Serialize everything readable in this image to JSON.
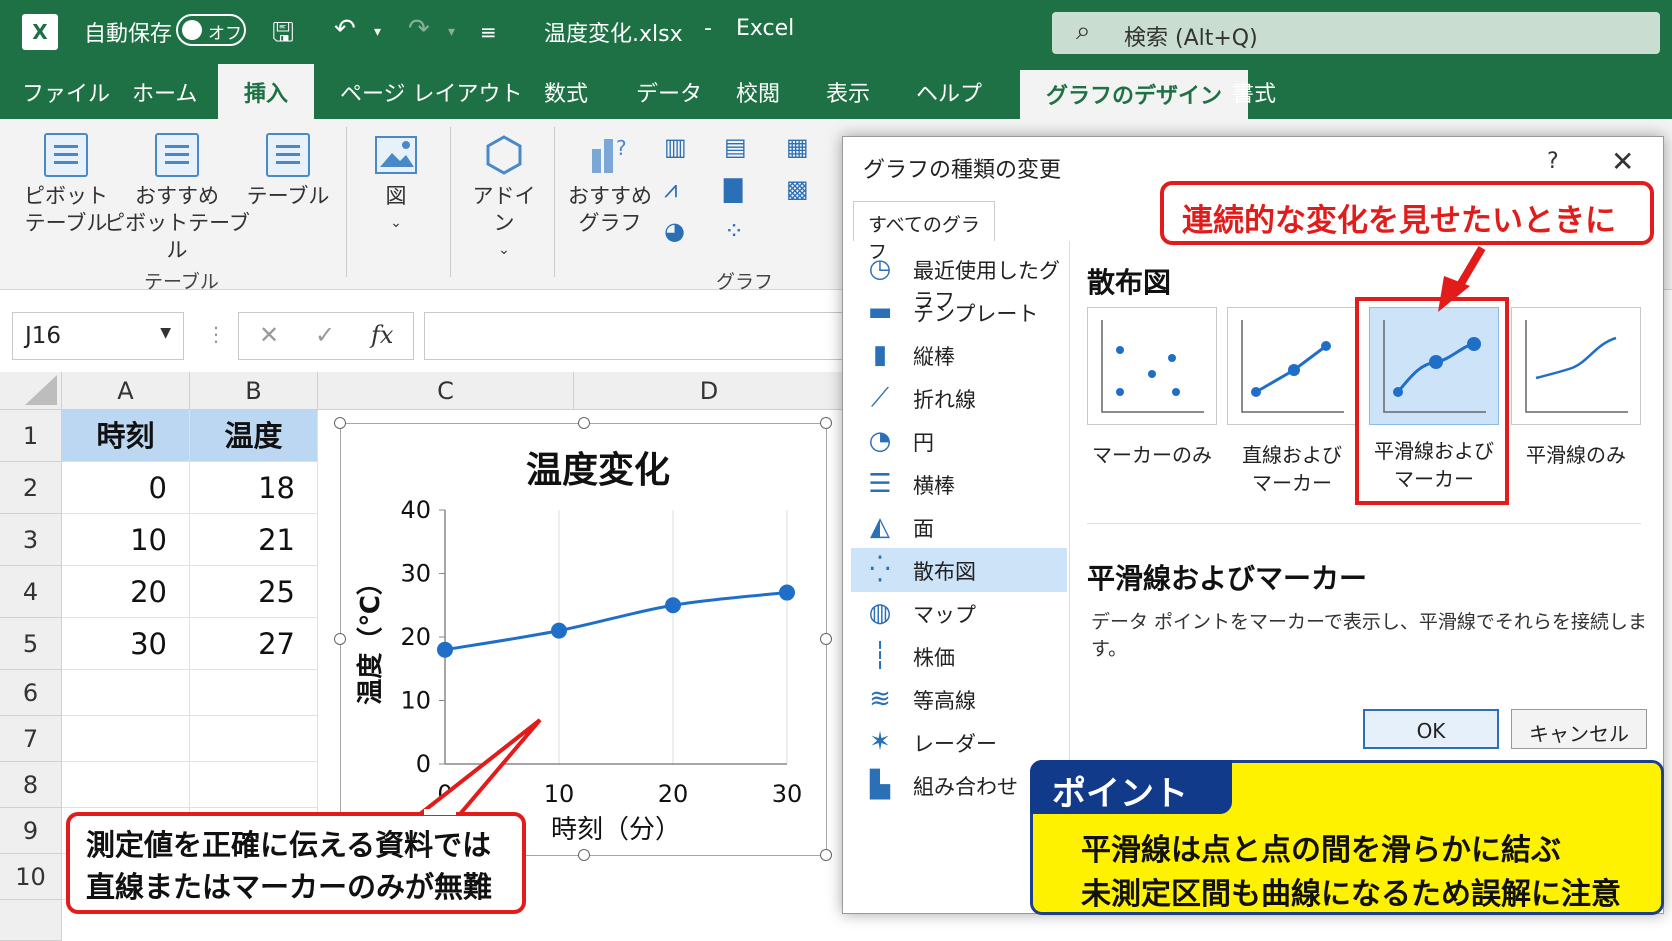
{
  "titlebar": {
    "app_icon": "excel-icon",
    "autosave_label": "自動保存",
    "autosave_state": "オフ",
    "filename": "温度変化.xlsx",
    "separator": "-",
    "app_name": "Excel",
    "search_placeholder": "検索 (Alt+Q)"
  },
  "tabs": [
    "ファイル",
    "ホーム",
    "挿入",
    "ページ レイアウト",
    "数式",
    "データ",
    "校閲",
    "表示",
    "ヘルプ",
    "グラフのデザイン",
    "書式"
  ],
  "active_tab": "挿入",
  "ribbon": {
    "pivot_line1": "ピボット",
    "pivot_line2": "テーブル",
    "rec_pivot_line1": "おすすめ",
    "rec_pivot_line2": "ピボットテーブル",
    "table": "テーブル",
    "group_table": "テーブル",
    "figure": "図",
    "addin": "アドイン",
    "rec_chart_line1": "おすすめ",
    "rec_chart_line2": "グラフ",
    "group_chart": "グラフ"
  },
  "formula_bar": {
    "namebox": "J16",
    "dots": "⋮",
    "cancel_glyph": "✕",
    "enter_glyph": "✓",
    "fx_glyph": "fx",
    "value": ""
  },
  "sheet": {
    "columns": [
      "A",
      "B",
      "C",
      "D"
    ],
    "rows": [
      "1",
      "2",
      "3",
      "4",
      "5",
      "6",
      "7",
      "8",
      "9",
      "10"
    ],
    "header": [
      "時刻",
      "温度"
    ],
    "data": [
      [
        "0",
        "18"
      ],
      [
        "10",
        "21"
      ],
      [
        "20",
        "25"
      ],
      [
        "30",
        "27"
      ]
    ]
  },
  "chart_data": {
    "type": "scatter",
    "title": "温度変化",
    "xlabel": "時刻（分）",
    "ylabel": "温度（℃）",
    "x": [
      0,
      10,
      20,
      30
    ],
    "series": [
      {
        "values": [
          18,
          21,
          25,
          27
        ]
      }
    ],
    "xlim": [
      0,
      30
    ],
    "ylim": [
      0,
      40
    ],
    "xticks": [
      0,
      10,
      20,
      30
    ],
    "yticks": [
      0,
      10,
      20,
      30,
      40
    ],
    "smooth": true,
    "markers": true,
    "grid": "vertical",
    "color": "#1f6fc9"
  },
  "dialog": {
    "title": "グラフの種類の変更",
    "help": "?",
    "close": "✕",
    "tab": "すべてのグラフ",
    "types": [
      {
        "label": "最近使用したグラフ",
        "icon": "clock-icon",
        "glyph": "◷"
      },
      {
        "label": "テンプレート",
        "icon": "folder-icon",
        "glyph": "▬"
      },
      {
        "label": "縦棒",
        "icon": "column-chart-icon",
        "glyph": "▮"
      },
      {
        "label": "折れ線",
        "icon": "line-chart-icon",
        "glyph": "⟋"
      },
      {
        "label": "円",
        "icon": "pie-chart-icon",
        "glyph": "◔"
      },
      {
        "label": "横棒",
        "icon": "bar-chart-icon",
        "glyph": "☰"
      },
      {
        "label": "面",
        "icon": "area-chart-icon",
        "glyph": "◭"
      },
      {
        "label": "散布図",
        "icon": "scatter-chart-icon",
        "glyph": "⁛"
      },
      {
        "label": "マップ",
        "icon": "globe-icon",
        "glyph": "◍"
      },
      {
        "label": "株価",
        "icon": "stock-chart-icon",
        "glyph": "┆"
      },
      {
        "label": "等高線",
        "icon": "surface-chart-icon",
        "glyph": "≋"
      },
      {
        "label": "レーダー",
        "icon": "radar-chart-icon",
        "glyph": "✶"
      },
      {
        "label": "組み合わせ",
        "icon": "combo-chart-icon",
        "glyph": "▙"
      }
    ],
    "selected_type": "散布図",
    "section_title": "散布図",
    "subtypes": [
      {
        "line1": "マーカーのみ",
        "line2": ""
      },
      {
        "line1": "直線および",
        "line2": "マーカー"
      },
      {
        "line1": "平滑線および",
        "line2": "マーカー"
      },
      {
        "line1": "平滑線のみ",
        "line2": ""
      }
    ],
    "selected_subtype": "平滑線およびマーカー",
    "desc_title": "平滑線およびマーカー",
    "desc_text": "データ ポイントをマーカーで表示し、平滑線でそれらを接続します。",
    "ok": "OK",
    "cancel": "キャンセル"
  },
  "callouts": {
    "top": "連続的な変化を見せたいときに",
    "bottom_line1": "測定値を正確に伝える資料では",
    "bottom_line2": "直線またはマーカーのみが無難",
    "point_title": "ポイント",
    "point_line1": "平滑線は点と点の間を滑らかに結ぶ",
    "point_line2": "未測定区間も曲線になるため誤解に注意"
  },
  "colors": {
    "excel_green": "#1e7145",
    "accent_blue": "#1f6fc9",
    "alert_red": "#e21b1b",
    "highlight_yellow": "#fff200",
    "navy": "#123a8a"
  }
}
